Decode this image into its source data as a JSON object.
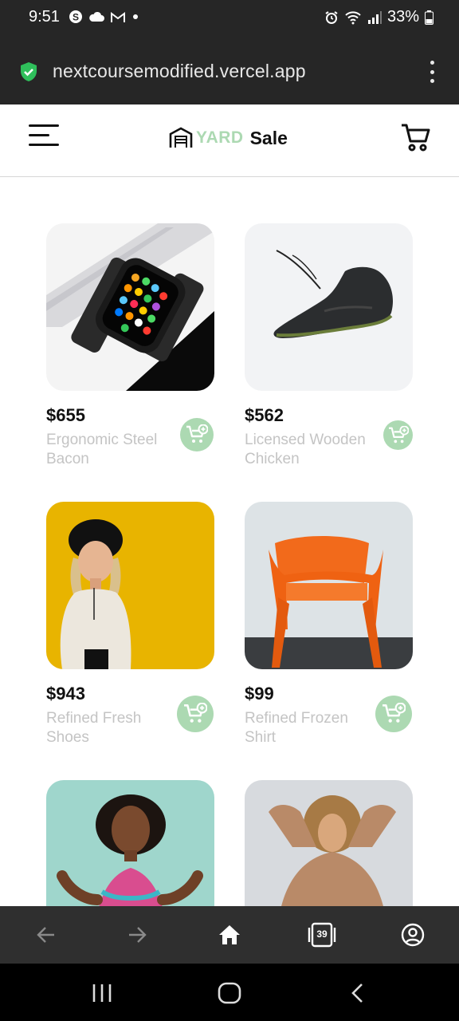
{
  "status_bar": {
    "time": "9:51",
    "battery": "33%"
  },
  "browser": {
    "url": "nextcoursemodified.vercel.app",
    "tab_count": "39"
  },
  "app": {
    "logo_yard": "YARD",
    "logo_sale": "Sale",
    "accent_color": "#acd9b2"
  },
  "products": [
    {
      "price": "$655",
      "name": "Ergonomic Steel Bacon"
    },
    {
      "price": "$562",
      "name": "Licensed Wooden Chicken"
    },
    {
      "price": "$943",
      "name": "Refined Fresh Shoes"
    },
    {
      "price": "$99",
      "name": "Refined Frozen Shirt"
    },
    {
      "price": "",
      "name": ""
    },
    {
      "price": "",
      "name": ""
    }
  ]
}
